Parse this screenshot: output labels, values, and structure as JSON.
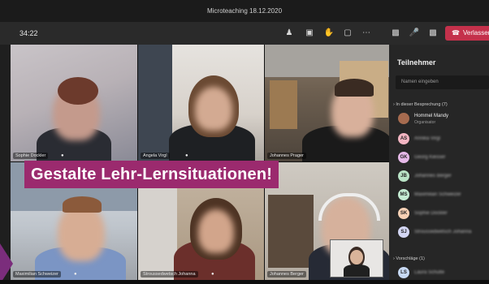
{
  "window": {
    "title": "Microteaching 18.12.2020"
  },
  "toolbar": {
    "timer": "34:22",
    "leave_label": "Verlassen"
  },
  "banner": {
    "text": "Gestalte Lehr-Lernsituationen!"
  },
  "tiles": [
    {
      "name": "Sophie Dockler"
    },
    {
      "name": "Angela Virgl"
    },
    {
      "name": "Johannes Prager"
    },
    {
      "name": "Maximilian Schweizer"
    },
    {
      "name": "Stroussedwetsch Johanna"
    },
    {
      "name": "Johannes Berger"
    }
  ],
  "participants_panel": {
    "title": "Teilnehmer",
    "search_placeholder": "Namen eingeben",
    "section_in_meeting": "In dieser Besprechung (7)",
    "organizer": {
      "name": "Hommel Mandy",
      "role": "Organisator"
    },
    "members": [
      {
        "initials": "AS",
        "name": "Annika Virgl",
        "color": "#f3b5c2"
      },
      {
        "initials": "GK",
        "name": "Georg Kiesser",
        "color": "#e6b9e8"
      },
      {
        "initials": "JB",
        "name": "Johannes Berger",
        "color": "#b9e3c6"
      },
      {
        "initials": "MS",
        "name": "Maximilian Schweizer",
        "color": "#c4ebd3"
      },
      {
        "initials": "SK",
        "name": "Sophie Dockler",
        "color": "#f7d1b5"
      },
      {
        "initials": "SJ",
        "name": "Stroussedwetsch Johanna",
        "color": "#d3d6f4"
      }
    ],
    "section_suggestions": "Vorschläge (1)",
    "suggestions": [
      {
        "initials": "LS",
        "name": "Laura Schulte",
        "color": "#c7d9f4"
      }
    ]
  }
}
